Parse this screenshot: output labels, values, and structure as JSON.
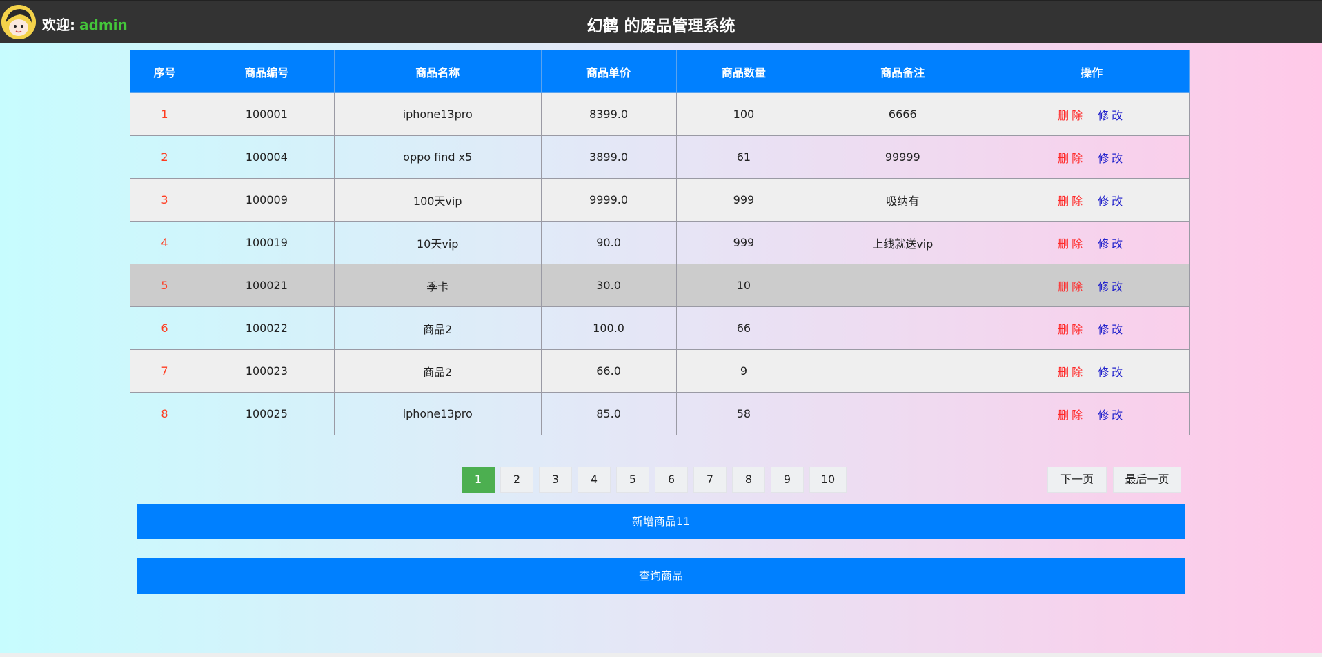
{
  "header": {
    "welcome_label": "欢迎:",
    "username": "admin",
    "title": "幻鹤 的废品管理系统"
  },
  "table": {
    "columns": [
      "序号",
      "商品编号",
      "商品名称",
      "商品单价",
      "商品数量",
      "商品备注",
      "操作"
    ],
    "action_delete": "删除",
    "action_edit": "修改",
    "rows": [
      {
        "idx": "1",
        "code": "100001",
        "name": "iphone13pro",
        "price": "8399.0",
        "qty": "100",
        "note": "6666"
      },
      {
        "idx": "2",
        "code": "100004",
        "name": "oppo find x5",
        "price": "3899.0",
        "qty": "61",
        "note": "99999"
      },
      {
        "idx": "3",
        "code": "100009",
        "name": "100天vip",
        "price": "9999.0",
        "qty": "999",
        "note": "吸纳有"
      },
      {
        "idx": "4",
        "code": "100019",
        "name": "10天vip",
        "price": "90.0",
        "qty": "999",
        "note": "上线就送vip"
      },
      {
        "idx": "5",
        "code": "100021",
        "name": "季卡",
        "price": "30.0",
        "qty": "10",
        "note": ""
      },
      {
        "idx": "6",
        "code": "100022",
        "name": "商品2",
        "price": "100.0",
        "qty": "66",
        "note": ""
      },
      {
        "idx": "7",
        "code": "100023",
        "name": "商品2",
        "price": "66.0",
        "qty": "9",
        "note": ""
      },
      {
        "idx": "8",
        "code": "100025",
        "name": "iphone13pro",
        "price": "85.0",
        "qty": "58",
        "note": ""
      }
    ]
  },
  "pagination": {
    "pages": [
      "1",
      "2",
      "3",
      "4",
      "5",
      "6",
      "7",
      "8",
      "9",
      "10"
    ],
    "current": "1",
    "next_label": "下一页",
    "last_label": "最后一页"
  },
  "buttons": {
    "add_label": "新增商品11",
    "query_label": "查询商品"
  },
  "colors": {
    "accent": "#0080ff",
    "active_page": "#4caf50",
    "delete": "#ff2a2a",
    "edit": "#2222cc",
    "username": "#44c63a"
  }
}
